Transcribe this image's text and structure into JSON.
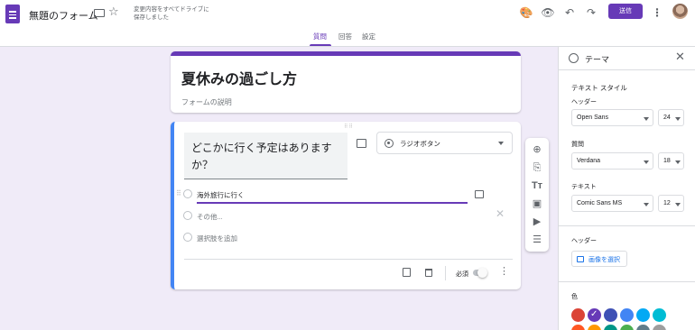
{
  "header": {
    "title": "無題のフォーム",
    "save_status": "変更内容をすべてドライブに保存しました",
    "send_label": "送信"
  },
  "tabs": [
    {
      "label": "質問",
      "active": true
    },
    {
      "label": "回答",
      "active": false
    },
    {
      "label": "設定",
      "active": false
    }
  ],
  "form": {
    "title": "夏休みの過ごし方",
    "description_placeholder": "フォームの説明"
  },
  "question": {
    "text": "どこかに行く予定はありますか？",
    "type": "ラジオボタン",
    "options": [
      "海外旅行に行く"
    ],
    "other_placeholder": "その他...",
    "add_option_placeholder": "選択肢を追加",
    "required_label": "必須",
    "required": false
  },
  "theme_panel": {
    "title": "テーマ",
    "text_style_label": "テキスト スタイル",
    "header_label": "ヘッダー",
    "header_font": "Open Sans",
    "header_size": "24",
    "question_label": "質問",
    "question_font": "Verdana",
    "question_size": "18",
    "text_label": "テキスト",
    "text_font": "Comic Sans MS",
    "text_size": "12",
    "header_image_label": "ヘッダー",
    "select_image_label": "画像を選択",
    "color_label": "色",
    "colors": [
      "#db4437",
      "#673ab7",
      "#3f51b5",
      "#4285f4",
      "#03a9f4",
      "#00bcd4",
      "#ff5722",
      "#ff9800",
      "#009688",
      "#4caf50",
      "#607d8b",
      "#9e9e9e"
    ],
    "selected_color": "#673ab7"
  },
  "accent_color": "#673ab7",
  "icons": [
    "forms-app-icon",
    "folder-icon",
    "star-icon",
    "palette-icon",
    "preview-icon",
    "undo-icon",
    "redo-icon",
    "more-vert-icon",
    "image-icon",
    "copy-icon",
    "trash-icon",
    "add-circle-icon",
    "import-icon",
    "title-icon",
    "image-add-icon",
    "video-icon",
    "section-icon",
    "close-icon"
  ]
}
